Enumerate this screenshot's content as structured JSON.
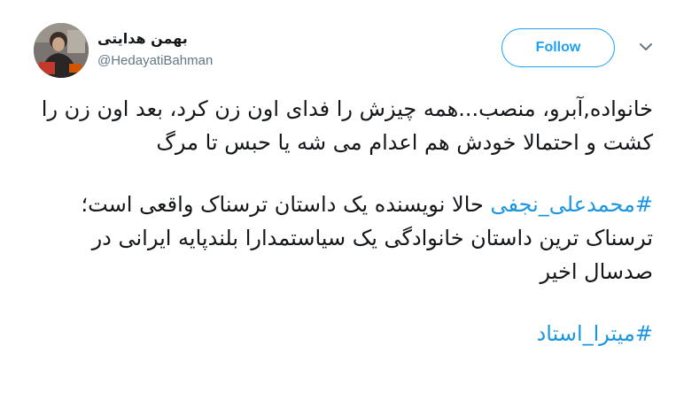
{
  "user": {
    "display_name": "بهمن هدایتی",
    "handle": "@HedayatiBahman"
  },
  "follow_label": "Follow",
  "icons": {
    "avatar": "profile-photo",
    "caret": "chevron-down-icon"
  },
  "colors": {
    "accent": "#1da1f2",
    "hashtag": "#1b95e0",
    "text": "#14171a",
    "muted": "#657786"
  },
  "tweet": {
    "para1": "خانواده,آبرو، منصب...همه چیزش را فدای اون زن کرد، بعد اون زن را کشت و احتمالا خودش هم اعدام می شه یا حبس تا مرگ",
    "para2_hashtag": "#محمدعلی_نجفی",
    "para2_text": " حالا نویسنده یک داستان ترسناک واقعی است؛ ترسناک ترین داستان خانوادگی یک سیاستمدارا بلندپایه ایرانی در صدسال اخیر",
    "para3_hashtag": "#میترا_استاد"
  }
}
